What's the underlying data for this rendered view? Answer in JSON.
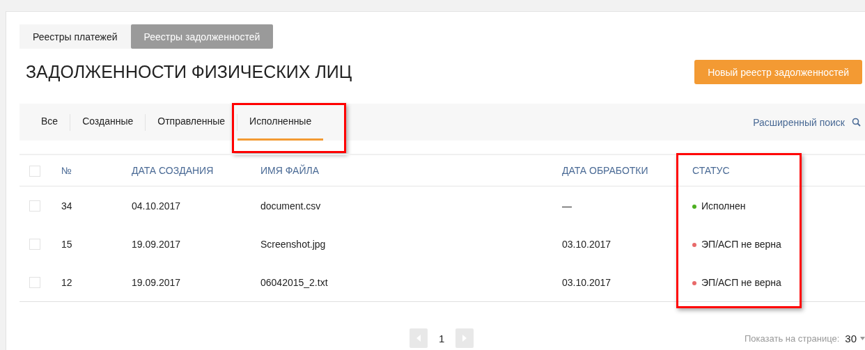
{
  "registry_tabs": [
    {
      "label": "Реестры платежей",
      "selected": false
    },
    {
      "label": "Реестры задолженностей",
      "selected": true
    }
  ],
  "title": "ЗАДОЛЖЕННОСТИ ФИЗИЧЕСКИХ ЛИЦ",
  "new_button": "Новый реестр задолженностей",
  "filter_tabs": [
    {
      "label": "Все",
      "selected": false,
      "highlighted": false
    },
    {
      "label": "Созданные",
      "selected": false,
      "highlighted": false
    },
    {
      "label": "Отправленные",
      "selected": false,
      "highlighted": false
    },
    {
      "label": "Исполненные",
      "selected": true,
      "highlighted": true
    }
  ],
  "advanced_search": "Расширенный поиск",
  "table": {
    "status_highlighted": true,
    "columns": [
      "№",
      "ДАТА СОЗДАНИЯ",
      "ИМЯ ФАЙЛА",
      "ДАТА ОБРАБОТКИ",
      "СТАТУС"
    ],
    "rows": [
      {
        "checked": false,
        "number": "34",
        "created": "04.10.2017",
        "file": "document.csv",
        "processed": "—",
        "status": "Исполнен",
        "color": "#4caf20"
      },
      {
        "checked": false,
        "number": "15",
        "created": "19.09.2017",
        "file": "Screenshot.jpg",
        "processed": "03.10.2017",
        "status": "ЭП/АСП не верна",
        "color": "#e86a6a"
      },
      {
        "checked": false,
        "number": "12",
        "created": "19.09.2017",
        "file": "06042015_2.txt",
        "processed": "03.10.2017",
        "status": "ЭП/АСП не верна",
        "color": "#e86a6a"
      }
    ]
  },
  "pagination": {
    "page": "1",
    "per_page_label": "Показать на странице:",
    "per_page": "30"
  },
  "select_all": {
    "checked": false
  }
}
